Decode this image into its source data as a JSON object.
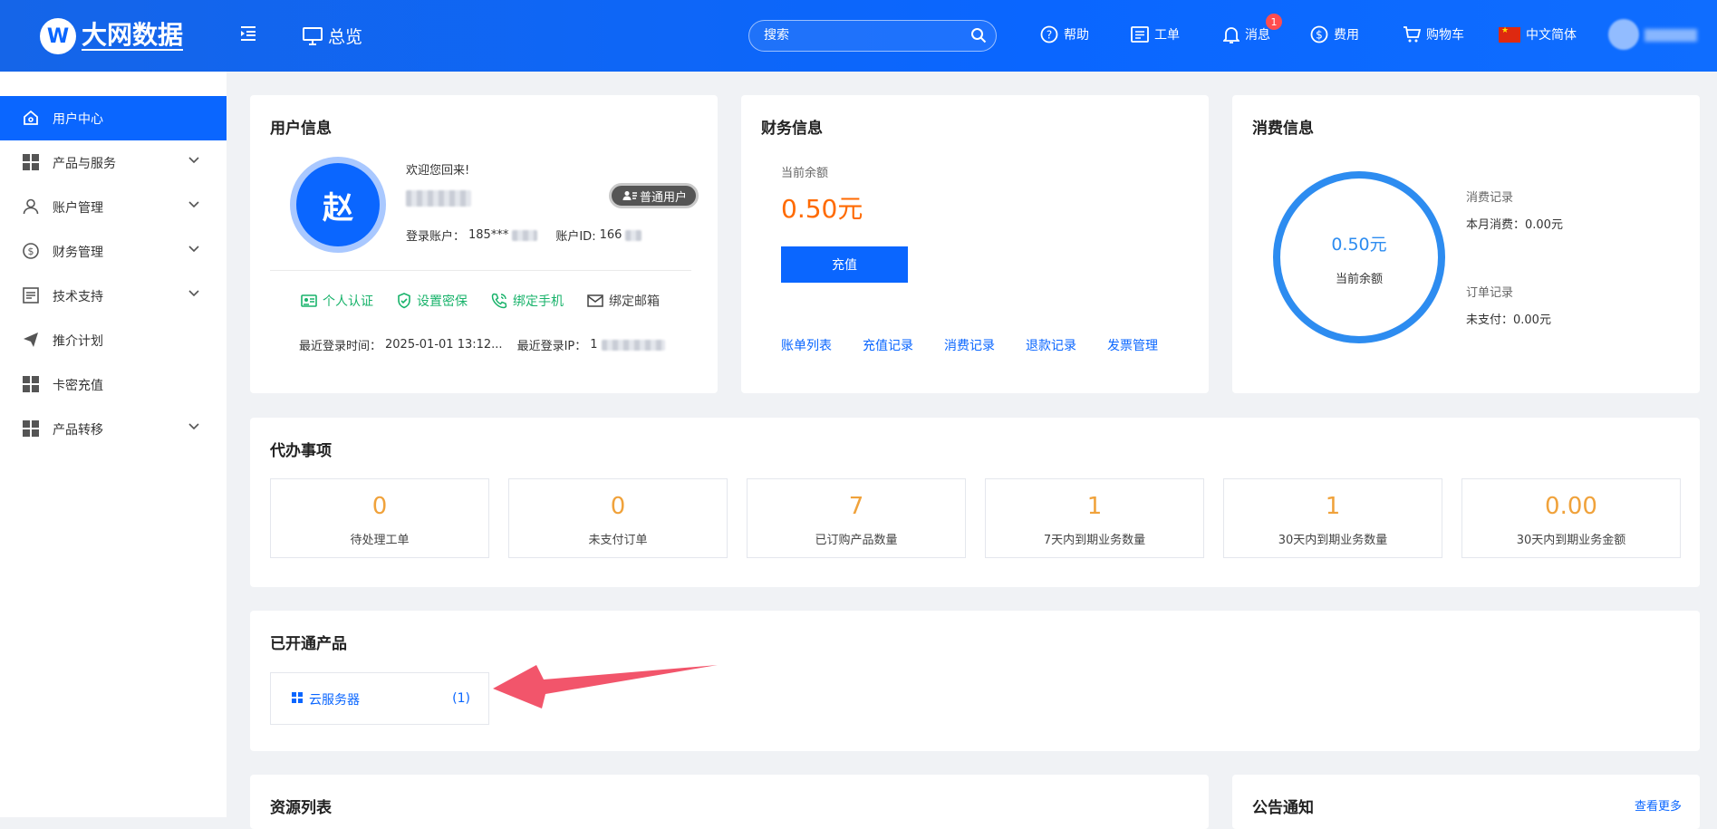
{
  "header": {
    "logo_mark": "W",
    "logo_text": "大网数据",
    "overview_label": "总览",
    "search_placeholder": "搜索",
    "nav": {
      "help": "帮助",
      "ticket": "工单",
      "message": "消息",
      "message_badge": "1",
      "fee": "费用",
      "cart": "购物车",
      "language": "中文简体"
    },
    "brand_color": "#0a66ff"
  },
  "sidebar": {
    "items": [
      {
        "label": "用户中心",
        "icon": "home-icon",
        "active": true
      },
      {
        "label": "产品与服务",
        "icon": "grid-icon",
        "expandable": true
      },
      {
        "label": "账户管理",
        "icon": "user-icon",
        "expandable": true
      },
      {
        "label": "财务管理",
        "icon": "dollar-icon",
        "expandable": true
      },
      {
        "label": "技术支持",
        "icon": "document-icon",
        "expandable": true
      },
      {
        "label": "推介计划",
        "icon": "send-icon"
      },
      {
        "label": "卡密充值",
        "icon": "grid-icon"
      },
      {
        "label": "产品转移",
        "icon": "grid-icon",
        "expandable": true
      }
    ]
  },
  "user_info": {
    "title": "用户信息",
    "avatar_char": "赵",
    "welcome": "欢迎您回来!",
    "user_type": "普通用户",
    "account_label": "登录账户：",
    "account_value": "185***",
    "account_id_label": "账户ID:",
    "account_id_value": "166",
    "links": [
      "个人认证",
      "设置密保",
      "绑定手机",
      "绑定邮箱"
    ],
    "last_login_time_label": "最近登录时间：",
    "last_login_time": "2025-01-01 13:12...",
    "last_login_ip_label": "最近登录IP：",
    "last_login_ip": "1"
  },
  "finance": {
    "title": "财务信息",
    "balance_label": "当前余额",
    "balance": "0.50元",
    "recharge_button": "充值",
    "links": [
      "账单列表",
      "充值记录",
      "消费记录",
      "退款记录",
      "发票管理"
    ]
  },
  "consumption": {
    "title": "消费信息",
    "ring_value": "0.50元",
    "ring_label": "当前余额",
    "consume_record_label": "消费记录",
    "month_consume": "本月消费：0.00元",
    "order_record_label": "订单记录",
    "unpaid": "未支付：0.00元",
    "ring_color": "#2d8cf0"
  },
  "todo": {
    "title": "代办事项",
    "stats": [
      {
        "value": "0",
        "label": "待处理工单"
      },
      {
        "value": "0",
        "label": "未支付订单"
      },
      {
        "value": "7",
        "label": "已订购产品数量"
      },
      {
        "value": "1",
        "label": "7天内到期业务数量"
      },
      {
        "value": "1",
        "label": "30天内到期业务数量"
      },
      {
        "value": "0.00",
        "label": "30天内到期业务金额"
      }
    ]
  },
  "products": {
    "title": "已开通产品",
    "items": [
      {
        "name": "云服务器",
        "count": "(1)"
      }
    ]
  },
  "resources": {
    "title": "资源列表"
  },
  "notice": {
    "title": "公告通知",
    "more": "查看更多"
  }
}
